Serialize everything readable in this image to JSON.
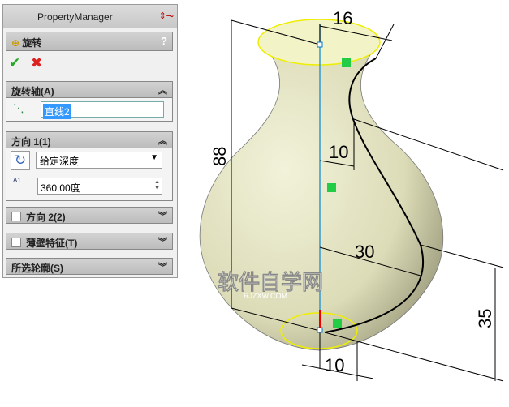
{
  "panel": {
    "title": "PropertyManager",
    "feature": "旋转",
    "help": "?"
  },
  "axis": {
    "label": "旋转轴(A)",
    "value": "直线2"
  },
  "dir1": {
    "label": "方向 1(1)",
    "type": "给定深度",
    "angle": "360.00度",
    "angle_icon": "A1"
  },
  "dir2": {
    "label": "方向 2(2)"
  },
  "thin": {
    "label": "薄壁特征(T)"
  },
  "contours": {
    "label": "所选轮廓(S)"
  },
  "dims": {
    "d16": "16",
    "d88": "88",
    "d10a": "10",
    "d30": "30",
    "d35": "35",
    "d10b": "10"
  },
  "watermark": {
    "main": "软件自学网",
    "sub": "RJZXW.COM"
  }
}
